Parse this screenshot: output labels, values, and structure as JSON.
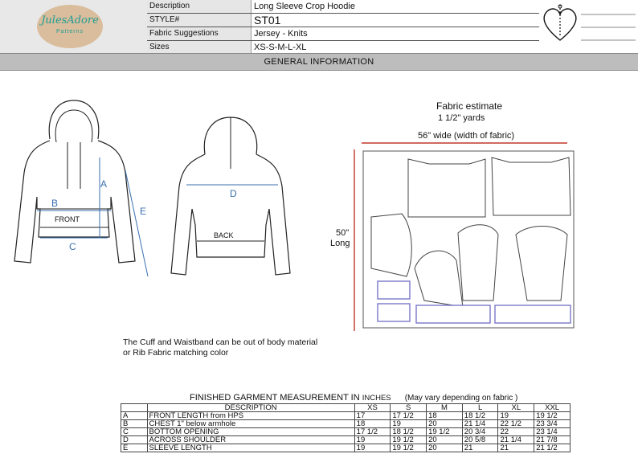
{
  "header": {
    "logo_text": "JulesAdore",
    "logo_sub": "Patterns",
    "rows": [
      {
        "label": "Description",
        "value": "Long Sleeve Crop Hoodie"
      },
      {
        "label": "STYLE#",
        "value": "ST01"
      },
      {
        "label": "Fabric Suggestions",
        "value": "Jersey - Knits"
      },
      {
        "label": "Sizes",
        "value": "XS-S-M-L-XL"
      }
    ]
  },
  "section_title": "GENERAL INFORMATION",
  "sketch": {
    "front_label": "FRONT",
    "back_label": "BACK",
    "measure_labels": [
      "A",
      "B",
      "C",
      "D",
      "E"
    ]
  },
  "note": {
    "line1": "The Cuff and Waistband can be out of body material",
    "line2": "or Rib Fabric matching color"
  },
  "fabric": {
    "estimate_label": "Fabric estimate",
    "estimate_value": "1 1/2\" yards",
    "width_label": "56\" wide  (width of fabric)",
    "length_value": "50\"",
    "length_word": "Long"
  },
  "measurements": {
    "title": "FINISHED GARMENT MEASUREMENT IN",
    "unit": "INCHES",
    "note": "(May vary depending on fabric )",
    "headers": [
      "",
      "DESCRIPTION",
      "XS",
      "S",
      "M",
      "L",
      "XL",
      "XXL"
    ],
    "rows": [
      [
        "A",
        "FRONT LENGTH from HPS",
        "17",
        "17 1/2",
        "18",
        "18 1/2",
        "19",
        "19 1/2"
      ],
      [
        "B",
        "CHEST 1\" below armhole",
        "18",
        "19",
        "20",
        "21 1/4",
        "22 1/2",
        "23 3/4"
      ],
      [
        "C",
        "BOTTOM OPENING",
        "17 1/2",
        "18 1/2",
        "19 1/2",
        "20 3/4",
        "22",
        "23 1/4"
      ],
      [
        "D",
        "ACROSS SHOULDER",
        "19",
        "19 1/2",
        "20",
        "20 5/8",
        "21 1/4",
        "21 7/8"
      ],
      [
        "E",
        "SLEEVE LENGTH",
        "19",
        "19 1/2",
        "20",
        "21",
        "21",
        "21 1/2"
      ]
    ]
  }
}
